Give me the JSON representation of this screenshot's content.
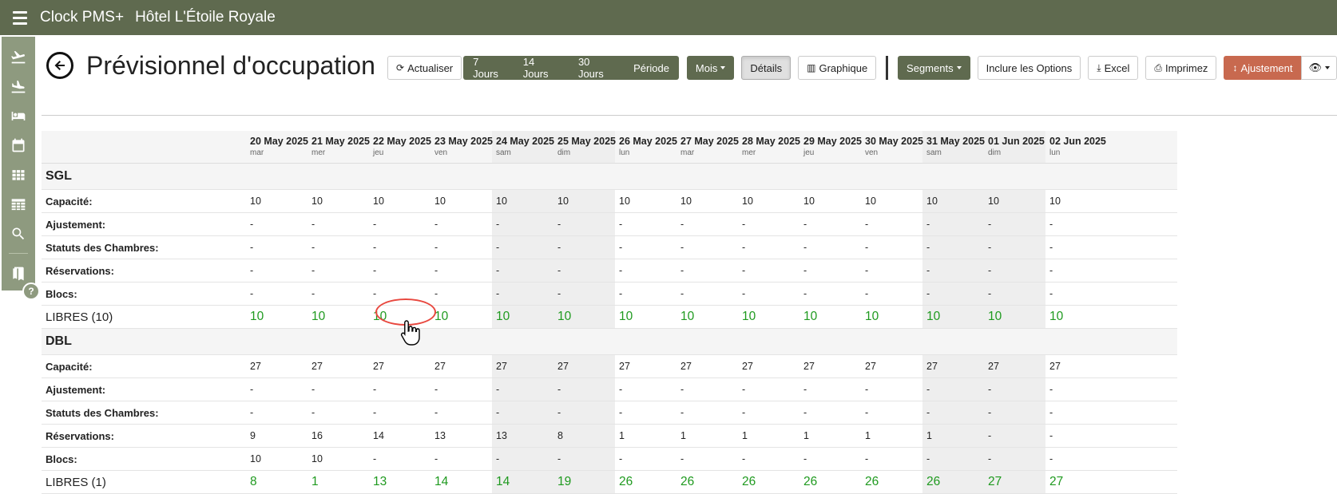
{
  "topbar": {
    "app_name": "Clock PMS+",
    "hotel_name": "Hôtel L'Étoile Royale"
  },
  "sidebar": {
    "items": [
      {
        "icon": "plane-departure-icon"
      },
      {
        "icon": "plane-arrival-icon"
      },
      {
        "icon": "bed-icon"
      },
      {
        "icon": "calendar-icon"
      },
      {
        "icon": "grid-icon"
      },
      {
        "icon": "table-icon"
      },
      {
        "icon": "search-icon"
      },
      {
        "icon": "book-icon"
      }
    ],
    "help_label": "?"
  },
  "header": {
    "title": "Prévisionnel d'occupation"
  },
  "toolbar": {
    "refresh": "Actualiser",
    "range_buttons": [
      "7 Jours",
      "14 Jours",
      "30 Jours",
      "Période"
    ],
    "month": "Mois",
    "details": "Détails",
    "graph": "Graphique",
    "segments": "Segments",
    "include_options": "Inclure les Options",
    "excel": "Excel",
    "print": "Imprimez",
    "adjustment": "Ajustement"
  },
  "days": [
    {
      "date": "20 May 2025",
      "name": "mar",
      "weekend": false
    },
    {
      "date": "21 May 2025",
      "name": "mer",
      "weekend": false
    },
    {
      "date": "22 May 2025",
      "name": "jeu",
      "weekend": false
    },
    {
      "date": "23 May 2025",
      "name": "ven",
      "weekend": false
    },
    {
      "date": "24 May 2025",
      "name": "sam",
      "weekend": true
    },
    {
      "date": "25 May 2025",
      "name": "dim",
      "weekend": true
    },
    {
      "date": "26 May 2025",
      "name": "lun",
      "weekend": false
    },
    {
      "date": "27 May 2025",
      "name": "mar",
      "weekend": false
    },
    {
      "date": "28 May 2025",
      "name": "mer",
      "weekend": false
    },
    {
      "date": "29 May 2025",
      "name": "jeu",
      "weekend": false
    },
    {
      "date": "30 May 2025",
      "name": "ven",
      "weekend": false
    },
    {
      "date": "31 May 2025",
      "name": "sam",
      "weekend": true
    },
    {
      "date": "01 Jun 2025",
      "name": "dim",
      "weekend": true
    },
    {
      "date": "02 Jun 2025",
      "name": "lun",
      "weekend": false
    }
  ],
  "sections": [
    {
      "name": "SGL",
      "rows": [
        {
          "label": "Capacité:",
          "values": [
            "10",
            "10",
            "10",
            "10",
            "10",
            "10",
            "10",
            "10",
            "10",
            "10",
            "10",
            "10",
            "10",
            "10"
          ]
        },
        {
          "label": "Ajustement:",
          "values": [
            "-",
            "-",
            "-",
            "-",
            "-",
            "-",
            "-",
            "-",
            "-",
            "-",
            "-",
            "-",
            "-",
            "-"
          ]
        },
        {
          "label": "Statuts des Chambres:",
          "values": [
            "-",
            "-",
            "-",
            "-",
            "-",
            "-",
            "-",
            "-",
            "-",
            "-",
            "-",
            "-",
            "-",
            "-"
          ]
        },
        {
          "label": "Réservations:",
          "values": [
            "-",
            "-",
            "-",
            "-",
            "-",
            "-",
            "-",
            "-",
            "-",
            "-",
            "-",
            "-",
            "-",
            "-"
          ]
        },
        {
          "label": "Blocs:",
          "values": [
            "-",
            "-",
            "-",
            "-",
            "-",
            "-",
            "-",
            "-",
            "-",
            "-",
            "-",
            "-",
            "-",
            "-"
          ]
        }
      ],
      "free": {
        "label": "LIBRES (10)",
        "values": [
          "10",
          "10",
          "10",
          "10",
          "10",
          "10",
          "10",
          "10",
          "10",
          "10",
          "10",
          "10",
          "10",
          "10"
        ]
      }
    },
    {
      "name": "DBL",
      "rows": [
        {
          "label": "Capacité:",
          "values": [
            "27",
            "27",
            "27",
            "27",
            "27",
            "27",
            "27",
            "27",
            "27",
            "27",
            "27",
            "27",
            "27",
            "27"
          ]
        },
        {
          "label": "Ajustement:",
          "values": [
            "-",
            "-",
            "-",
            "-",
            "-",
            "-",
            "-",
            "-",
            "-",
            "-",
            "-",
            "-",
            "-",
            "-"
          ]
        },
        {
          "label": "Statuts des Chambres:",
          "values": [
            "-",
            "-",
            "-",
            "-",
            "-",
            "-",
            "-",
            "-",
            "-",
            "-",
            "-",
            "-",
            "-",
            "-"
          ]
        },
        {
          "label": "Réservations:",
          "values": [
            "9",
            "16",
            "14",
            "13",
            "13",
            "8",
            "1",
            "1",
            "1",
            "1",
            "1",
            "1",
            "-",
            "-"
          ]
        },
        {
          "label": "Blocs:",
          "values": [
            "10",
            "10",
            "-",
            "-",
            "-",
            "-",
            "-",
            "-",
            "-",
            "-",
            "-",
            "-",
            "-",
            "-"
          ]
        }
      ],
      "free": {
        "label": "LIBRES (1)",
        "values": [
          "8",
          "1",
          "13",
          "14",
          "14",
          "19",
          "26",
          "26",
          "26",
          "26",
          "26",
          "26",
          "27",
          "27"
        ]
      }
    }
  ],
  "colors": {
    "topbar": "#5f6a4f",
    "sidebar": "#8e9a7f",
    "free_value": "#1f9a1f",
    "adjustment_button": "#c8694f",
    "highlight_ring": "#e8483f"
  }
}
